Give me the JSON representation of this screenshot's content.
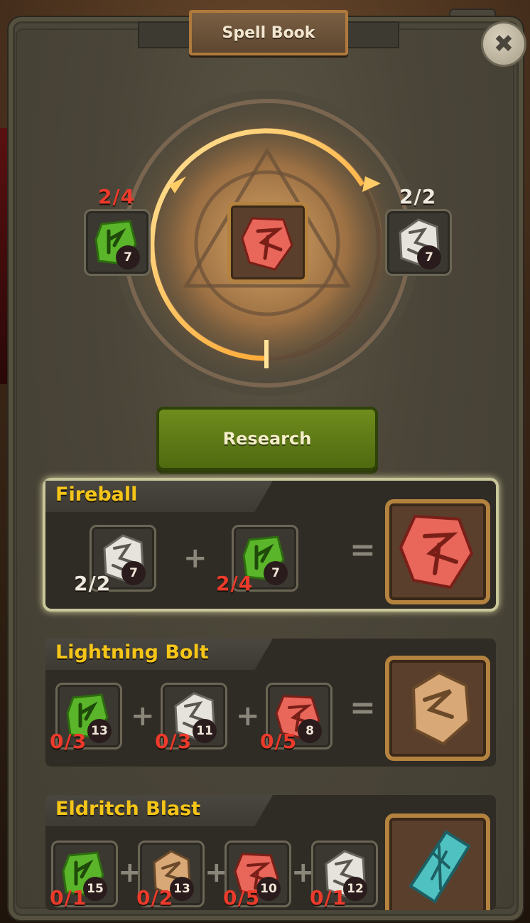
{
  "header": {
    "title": "Spell Book",
    "close_label": "✖"
  },
  "ring": {
    "progress": 0.5,
    "left_rune": {
      "name": "nature-rune",
      "count": "7",
      "fraction": "2/4",
      "fraction_color": "#ec3a2b"
    },
    "center_rune": {
      "name": "fire-rune"
    },
    "right_rune": {
      "name": "stone-rune",
      "count": "7",
      "fraction": "2/2",
      "fraction_color": "#efeae0"
    }
  },
  "research_button": {
    "label": "Research"
  },
  "recipes": [
    {
      "title": "Fireball",
      "selected": true,
      "ingredients": [
        {
          "rune": "stone-rune",
          "count": "7",
          "fraction": "2/2",
          "fraction_color": "white"
        },
        {
          "rune": "nature-rune",
          "count": "7",
          "fraction": "2/4",
          "fraction_color": "red"
        }
      ],
      "result": "fire-rune"
    },
    {
      "title": "Lightning Bolt",
      "selected": false,
      "ingredients": [
        {
          "rune": "nature-rune",
          "count": "13",
          "fraction": "0/3",
          "fraction_color": "red"
        },
        {
          "rune": "stone-rune",
          "count": "11",
          "fraction": "0/3",
          "fraction_color": "red"
        },
        {
          "rune": "fire-rune",
          "count": "8",
          "fraction": "0/5",
          "fraction_color": "red"
        }
      ],
      "result": "lightning-rune"
    },
    {
      "title": "Eldritch Blast",
      "selected": false,
      "ingredients": [
        {
          "rune": "nature-rune",
          "count": "15",
          "fraction": "0/1",
          "fraction_color": "red"
        },
        {
          "rune": "lightning-rune",
          "count": "13",
          "fraction": "0/2",
          "fraction_color": "red"
        },
        {
          "rune": "fire-rune",
          "count": "10",
          "fraction": "0/5",
          "fraction_color": "red"
        },
        {
          "rune": "stone-rune",
          "count": "12",
          "fraction": "0/1",
          "fraction_color": "red"
        }
      ],
      "result": "eldritch-rune"
    }
  ],
  "colors": {
    "accent_gold": "#f5c518",
    "fraction_red": "#ec3a2b",
    "button_green": "#6f8c1d"
  }
}
